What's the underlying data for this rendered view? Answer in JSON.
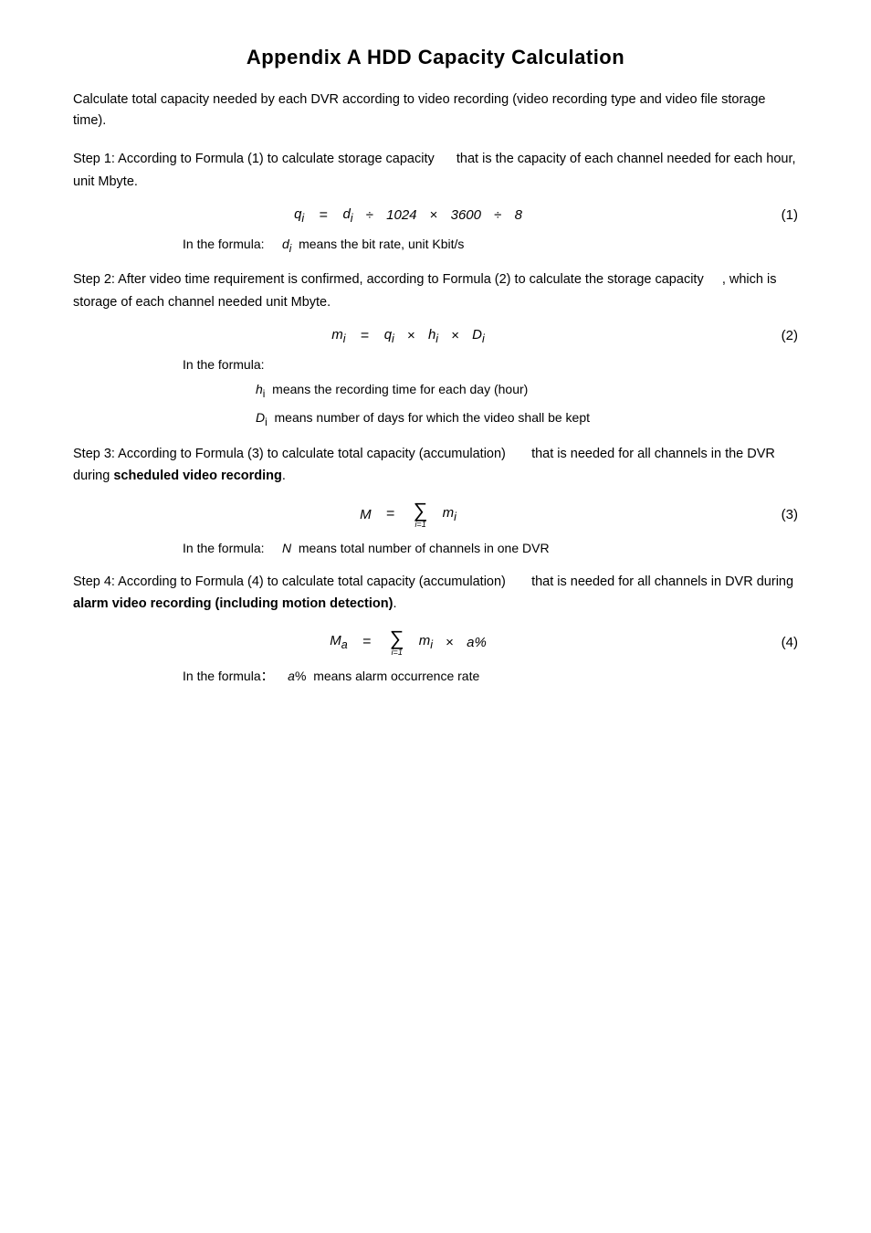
{
  "page": {
    "title": "Appendix A  HDD Capacity Calculation",
    "intro": "Calculate total capacity needed by each DVR according to video recording (video recording type and video file storage time).",
    "step1": {
      "text": "Step 1: According to Formula (1) to calculate storage capacity     that is the capacity of each channel needed for each hour, unit Mbyte.",
      "formula": "=   ÷  ×       ÷",
      "formula_number": "(1)",
      "note": "In the formula:     means the bit rate, unit Kbit/s"
    },
    "step2": {
      "text": "Step 2: After video time requirement is confirmed, according to Formula (2) to calculate the storage capacity    , which is storage of each channel needed unit Mbyte.",
      "formula": "=   ×   ×",
      "formula_number": "(2)",
      "notes": [
        "In the formula:",
        "means the recording time for each day (hour)",
        "means number of days for which the video shall be kept"
      ]
    },
    "step3": {
      "text1": "Step 3: According to Formula (3) to calculate total capacity (accumulation)       that is needed for",
      "text2": "all channels in the DVR during",
      "text2_bold": "scheduled video recording",
      "text2_end": ".",
      "formula_number": "(3)",
      "note": "In the formula:     means total number of channels in one DVR"
    },
    "step4": {
      "text1": "Step 4: According to Formula (4) to calculate total capacity (accumulation)       that is needed for",
      "text2": "all channels in DVR during",
      "text2_bold": "alarm video recording (including motion detection)",
      "text2_end": ".",
      "formula_number": "(4)",
      "note1": "In the formula：",
      "note2": "means alarm occurrence rate"
    }
  }
}
